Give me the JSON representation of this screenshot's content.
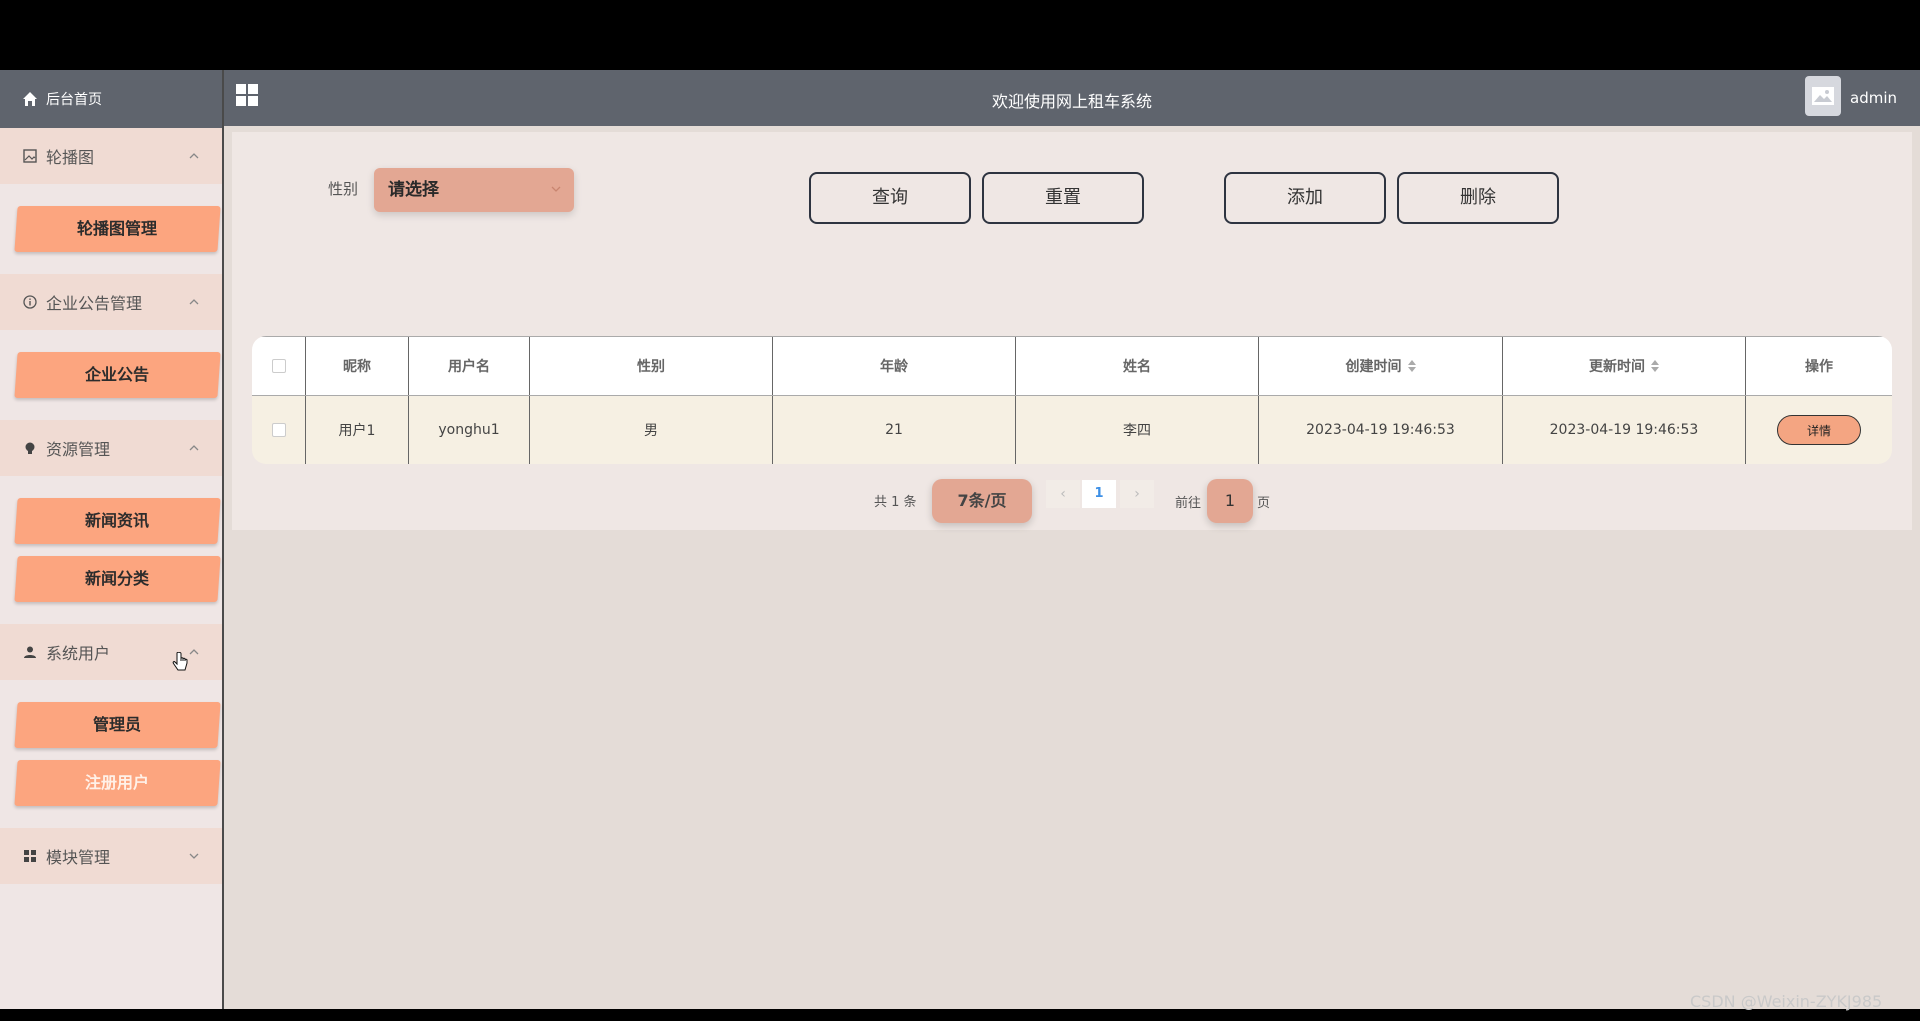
{
  "header": {
    "title": "欢迎使用网上租车系统",
    "user": "admin"
  },
  "sidebar": {
    "home": "后台首页",
    "groups": [
      {
        "label": "轮播图",
        "items": [
          "轮播图管理"
        ]
      },
      {
        "label": "企业公告管理",
        "items": [
          "企业公告"
        ]
      },
      {
        "label": "资源管理",
        "items": [
          "新闻资讯",
          "新闻分类"
        ]
      },
      {
        "label": "系统用户",
        "items": [
          "管理员",
          "注册用户"
        ]
      },
      {
        "label": "模块管理",
        "items": []
      }
    ]
  },
  "filter": {
    "gender_label": "性别",
    "gender_placeholder": "请选择"
  },
  "buttons": {
    "query": "查询",
    "reset": "重置",
    "add": "添加",
    "delete": "删除"
  },
  "table": {
    "headers": [
      "昵称",
      "用户名",
      "性别",
      "年龄",
      "姓名",
      "创建时间",
      "更新时间",
      "操作"
    ],
    "rows": [
      {
        "nickname": "用户1",
        "username": "yonghu1",
        "gender": "男",
        "age": "21",
        "name": "李四",
        "created": "2023-04-19 19:46:53",
        "updated": "2023-04-19 19:46:53",
        "action": "详情"
      }
    ]
  },
  "pager": {
    "total": "共 1 条",
    "page_size": "7条/页",
    "prev": "‹",
    "current": "1",
    "next": "›",
    "goto_label": "前往",
    "goto_value": "1",
    "page_suffix": "页"
  },
  "watermark": "CSDN @Weixin-ZYKJ985"
}
